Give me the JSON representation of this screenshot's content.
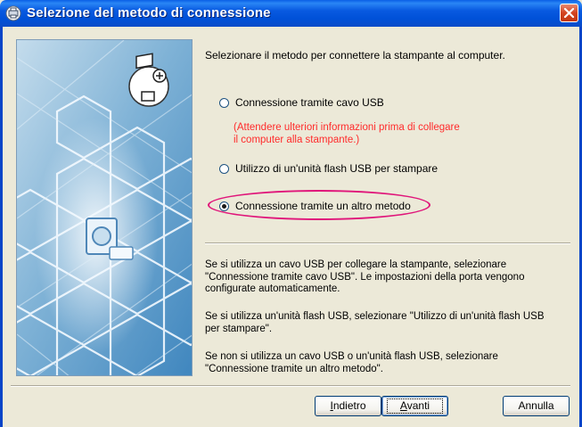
{
  "window": {
    "title": "Selezione del metodo di connessione",
    "title_icon": "printer-setup-icon",
    "close_icon": "close-icon"
  },
  "main": {
    "prompt": "Selezionare il metodo per connettere la stampante al computer.",
    "options": [
      {
        "label": "Connessione tramite cavo USB",
        "selected": false
      },
      {
        "label": "Utilizzo di un'unità flash USB per stampare",
        "selected": false
      },
      {
        "label": "Connessione tramite un altro metodo",
        "selected": true
      }
    ],
    "warning_line1": "(Attendere ulteriori informazioni prima di collegare",
    "warning_line2": "il computer alla stampante.)",
    "warning_color": "#FF2B2B",
    "highlight_color": "#E0157A",
    "desc1_line1": "Se si utilizza un cavo USB per collegare la stampante, selezionare",
    "desc1_line2": "\"Connessione tramite cavo USB\". Le impostazioni della porta vengono",
    "desc1_line3": "configurate automaticamente.",
    "desc2_line1": "Se si utilizza un'unità flash USB, selezionare \"Utilizzo di un'unità flash USB",
    "desc2_line2": "per stampare\".",
    "desc3_line1": "Se non si utilizza un cavo USB o un'unità flash USB, selezionare",
    "desc3_line2": "\"Connessione tramite un altro metodo\"."
  },
  "buttons": {
    "back": {
      "accel": "I",
      "rest": "ndietro"
    },
    "next": {
      "accel": "A",
      "rest": "vanti"
    },
    "cancel": "Annulla"
  },
  "colors": {
    "titlebar": "#0A58E0",
    "panel": "#5E9CC8"
  }
}
